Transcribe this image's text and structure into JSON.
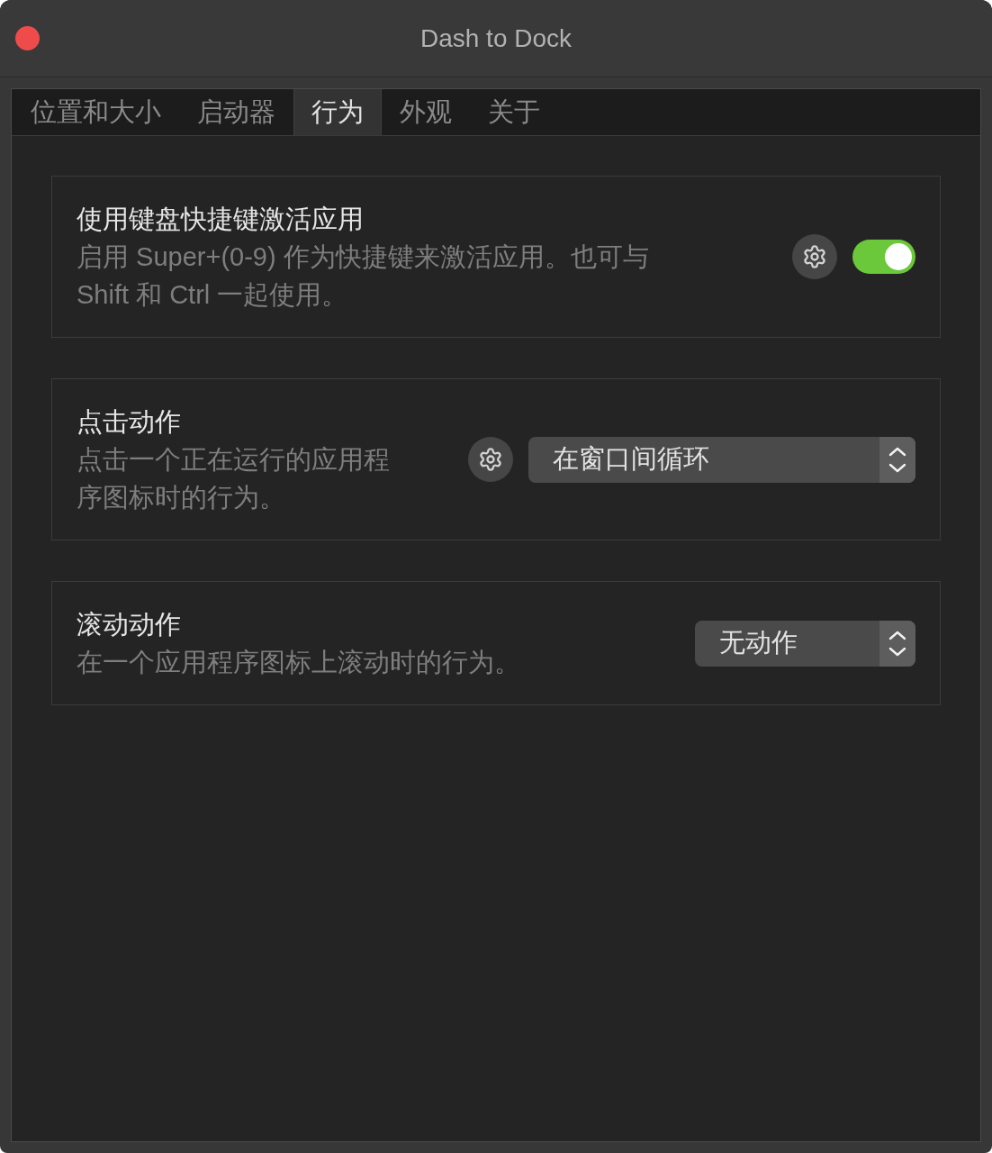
{
  "window": {
    "title": "Dash to Dock"
  },
  "tabs": [
    {
      "label": "位置和大小",
      "selected": false
    },
    {
      "label": "启动器",
      "selected": false
    },
    {
      "label": "行为",
      "selected": true
    },
    {
      "label": "外观",
      "selected": false
    },
    {
      "label": "关于",
      "selected": false
    }
  ],
  "settings": [
    {
      "kind": "switch",
      "title": "使用键盘快捷键激活应用",
      "description": "启用 Super+(0-9) 作为快捷键来激活应用。也可与 Shift 和 Ctrl 一起使用。",
      "settings_button": true,
      "on": true
    },
    {
      "kind": "dropdown",
      "title": "点击动作",
      "description": "点击一个正在运行的应用程序图标时的行为。",
      "settings_button": true,
      "value": "在窗口间循环"
    },
    {
      "kind": "dropdown",
      "title": "滚动动作",
      "description": "在一个应用程序图标上滚动时的行为。",
      "settings_button": false,
      "value": "无动作"
    }
  ]
}
